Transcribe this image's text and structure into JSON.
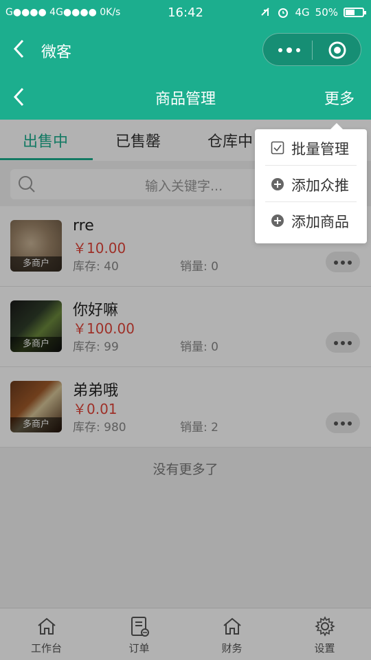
{
  "status_bar": {
    "left": "G●●●● 4G●●●● 0K/s",
    "time": "16:42",
    "network": "4G",
    "battery": "50%"
  },
  "mp_bar": {
    "title": "微客"
  },
  "header": {
    "title": "商品管理",
    "more": "更多"
  },
  "tabs": [
    {
      "label": "出售中",
      "active": true
    },
    {
      "label": "已售罄",
      "active": false
    },
    {
      "label": "仓库中",
      "active": false
    }
  ],
  "search": {
    "placeholder": "输入关键字..."
  },
  "products": [
    {
      "name": "rre",
      "price": "￥10.00",
      "stock": "库存: 40",
      "sales": "销量: 0",
      "tag": "多商户"
    },
    {
      "name": "你好嘛",
      "price": "￥100.00",
      "stock": "库存: 99",
      "sales": "销量: 0",
      "tag": "多商户"
    },
    {
      "name": "弟弟哦",
      "price": "￥0.01",
      "stock": "库存: 980",
      "sales": "销量: 2",
      "tag": "多商户"
    }
  ],
  "no_more": "没有更多了",
  "dropdown": [
    {
      "label": "批量管理",
      "icon": "checkbox-icon"
    },
    {
      "label": "添加众推",
      "icon": "plus-circle-icon"
    },
    {
      "label": "添加商品",
      "icon": "plus-circle-icon"
    }
  ],
  "tabbar": [
    {
      "label": "工作台",
      "icon": "home-icon"
    },
    {
      "label": "订单",
      "icon": "order-icon"
    },
    {
      "label": "财务",
      "icon": "home-icon"
    },
    {
      "label": "设置",
      "icon": "gear-icon"
    }
  ],
  "colors": {
    "primary": "#1cae8e",
    "price": "#e2453a"
  }
}
